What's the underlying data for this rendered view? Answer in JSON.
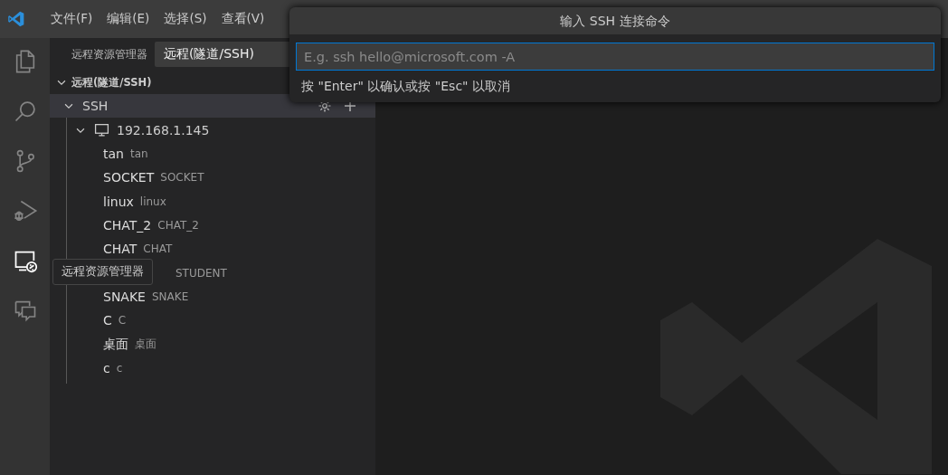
{
  "menu": [
    "文件(F)",
    "编辑(E)",
    "选择(S)",
    "查看(V)"
  ],
  "activity_bar": [
    {
      "kind": "files",
      "selected": false
    },
    {
      "kind": "search",
      "selected": false
    },
    {
      "kind": "source-control",
      "selected": false
    },
    {
      "kind": "debug",
      "selected": false
    },
    {
      "kind": "remote",
      "selected": true
    },
    {
      "kind": "comments",
      "selected": false
    }
  ],
  "tooltip": "远程资源管理器",
  "sidebar": {
    "title": "远程资源管理器",
    "dropdown": "远程(隧道/SSH)",
    "section": {
      "label": "远程(隧道/SSH)",
      "expanded": true
    },
    "groups": [
      {
        "label": "SSH",
        "expanded": true,
        "hosts": [
          {
            "label": "192.168.1.145",
            "expanded": true,
            "children": [
              {
                "name": "tan",
                "description": "tan"
              },
              {
                "name": "SOCKET",
                "description": "SOCKET"
              },
              {
                "name": "linux",
                "description": "linux"
              },
              {
                "name": "CHAT_2",
                "description": "CHAT_2"
              },
              {
                "name": "CHAT",
                "description": "CHAT"
              },
              {
                "description": "STUDENT"
              },
              {
                "name": "SNAKE",
                "description": "SNAKE"
              },
              {
                "name": "C",
                "description": "C"
              },
              {
                "name": "桌面",
                "description": "桌面"
              },
              {
                "name": "c",
                "description": "c"
              }
            ]
          }
        ]
      }
    ]
  },
  "quick_input": {
    "title": "输入 SSH 连接命令",
    "placeholder": "E.g. ssh hello@microsoft.com -A",
    "hint": "按 \"Enter\" 以确认或按 \"Esc\" 以取消"
  }
}
